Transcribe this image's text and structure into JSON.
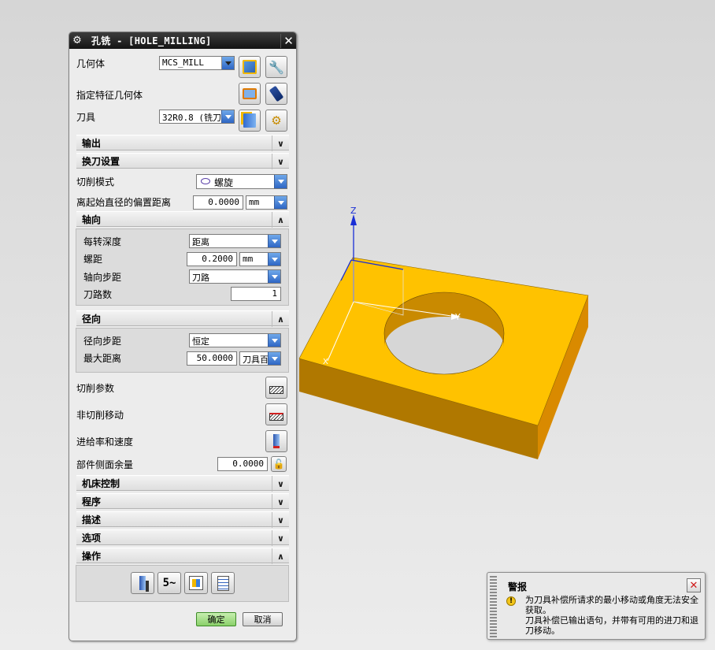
{
  "dialog": {
    "title": "孔铣 - [HOLE_MILLING]",
    "geometry_label": "几何体",
    "geometry_value": "MCS_MILL",
    "specify_feature_label": "指定特征几何体",
    "tool_label": "刀具",
    "tool_value": "32R0.8 (铣刀",
    "sections": {
      "output": "输出",
      "tool_change": "换刀设置",
      "axial": "轴向",
      "radial": "径向",
      "machine_control": "机床控制",
      "program": "程序",
      "description": "描述",
      "options": "选项",
      "actions": "操作"
    },
    "cut_mode_label": "切削模式",
    "cut_mode_value": "螺旋",
    "offset_label": "离起始直径的偏置距离",
    "offset_value": "0.0000",
    "offset_unit": "mm",
    "depth_per_rev_label": "每转深度",
    "depth_per_rev_value": "距离",
    "pitch_label": "螺距",
    "pitch_value": "0.2000",
    "pitch_unit": "mm",
    "axial_step_label": "轴向步距",
    "axial_step_value": "刀路",
    "num_passes_label": "刀路数",
    "num_passes_value": "1",
    "radial_step_label": "径向步距",
    "radial_step_value": "恒定",
    "max_distance_label": "最大距离",
    "max_distance_value": "50.0000",
    "max_distance_unit": "刀具百",
    "cut_params_label": "切削参数",
    "non_cut_label": "非切削移动",
    "feeds_label": "进给率和速度",
    "stock_label": "部件侧面余量",
    "stock_value": "0.0000",
    "ok_label": "确定",
    "cancel_label": "取消"
  },
  "viewport": {
    "axis_z": "Z",
    "axis_y": "Y",
    "axis_x": "X",
    "part_color": "#ffc200"
  },
  "warning": {
    "title": "警报",
    "line1": "为刀具补偿所请求的最小移动或角度无法安全获取。",
    "line2": "刀具补偿已输出语句，并带有可用的进刀和退刀移动。"
  }
}
